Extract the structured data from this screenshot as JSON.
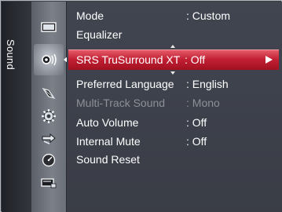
{
  "tab": {
    "label": "Sound"
  },
  "menu": {
    "items": [
      {
        "label": "Mode",
        "value": ": Custom",
        "enabled": true
      },
      {
        "label": "Equalizer",
        "value": "",
        "enabled": true
      },
      {
        "label": "SRS TruSurround XT",
        "value": ": Off",
        "enabled": true,
        "selected": true
      },
      {
        "label": "Preferred Language",
        "value": ": English",
        "enabled": true
      },
      {
        "label": "Multi-Track Sound",
        "value": ": Mono",
        "enabled": false
      },
      {
        "label": "Auto Volume",
        "value": ": Off",
        "enabled": true
      },
      {
        "label": "Internal Mute",
        "value": ": Off",
        "enabled": true
      },
      {
        "label": "Sound Reset",
        "value": "",
        "enabled": true
      }
    ]
  },
  "category_icons": [
    "picture-icon",
    "sound-icon",
    "channel-icon",
    "setup-icon",
    "input-icon",
    "application-icon",
    "support-icon"
  ],
  "colors": {
    "selection": "#c11f33",
    "menu_background": "#3d404a",
    "icon_column": "#747882",
    "disabled_text": "#8d9097"
  }
}
